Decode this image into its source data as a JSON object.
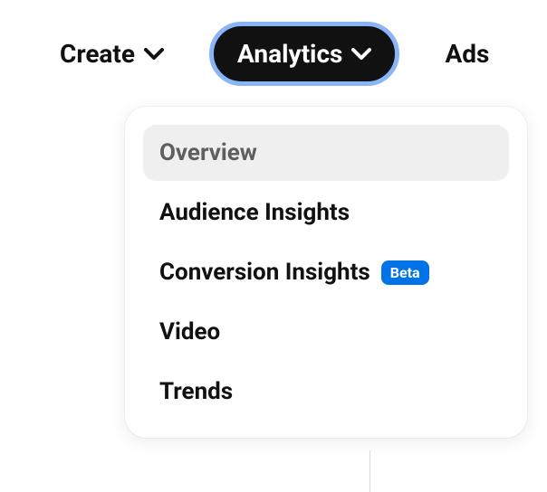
{
  "nav": {
    "items": [
      {
        "label": "Create",
        "hasChevron": true,
        "active": false
      },
      {
        "label": "Analytics",
        "hasChevron": true,
        "active": true
      },
      {
        "label": "Ads",
        "hasChevron": false,
        "active": false
      }
    ]
  },
  "dropdown": {
    "items": [
      {
        "label": "Overview",
        "highlighted": true,
        "badge": null
      },
      {
        "label": "Audience Insights",
        "highlighted": false,
        "badge": null
      },
      {
        "label": "Conversion Insights",
        "highlighted": false,
        "badge": "Beta"
      },
      {
        "label": "Video",
        "highlighted": false,
        "badge": null
      },
      {
        "label": "Trends",
        "highlighted": false,
        "badge": null
      }
    ]
  },
  "badge_text": "Beta"
}
